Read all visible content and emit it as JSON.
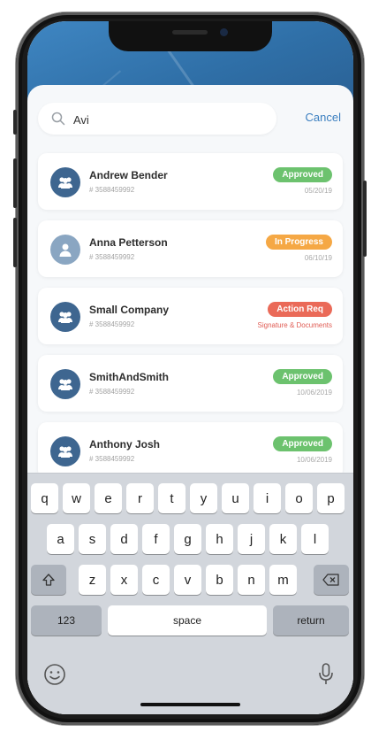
{
  "search": {
    "value": "Avi",
    "cancel_label": "Cancel"
  },
  "colors": {
    "approved": "#6cc26e",
    "in_progress": "#f5a845",
    "action_req": "#ea6a58",
    "accent": "#3b7fc0"
  },
  "items": [
    {
      "name": "Andrew Bender",
      "id": "# 3588459992",
      "status": "Approved",
      "meta": "05/20/19",
      "status_color": "#6cc26e",
      "avatar": "group-icon"
    },
    {
      "name": "Anna Petterson",
      "id": "# 3588459992",
      "status": "In Progress",
      "meta": "06/10/19",
      "status_color": "#f5a845",
      "avatar": "person-icon"
    },
    {
      "name": "Small Company",
      "id": "# 3588459992",
      "status": "Action Req",
      "meta": "Signature & Documents",
      "status_color": "#ea6a58",
      "avatar": "group-icon"
    },
    {
      "name": "SmithAndSmith",
      "id": "# 3588459992",
      "status": "Approved",
      "meta": "10/06/2019",
      "status_color": "#6cc26e",
      "avatar": "group-icon"
    },
    {
      "name": "Anthony Josh",
      "id": "# 3588459992",
      "status": "Approved",
      "meta": "10/06/2019",
      "status_color": "#6cc26e",
      "avatar": "group-icon"
    }
  ],
  "keyboard": {
    "row1": [
      "q",
      "w",
      "e",
      "r",
      "t",
      "y",
      "u",
      "i",
      "o",
      "p"
    ],
    "row2": [
      "a",
      "s",
      "d",
      "f",
      "g",
      "h",
      "j",
      "k",
      "l"
    ],
    "row3": [
      "z",
      "x",
      "c",
      "v",
      "b",
      "n",
      "m"
    ],
    "numbers_label": "123",
    "space_label": "space",
    "return_label": "return",
    "icons": [
      "shift-icon",
      "backspace-icon",
      "emoji-icon",
      "microphone-icon"
    ]
  }
}
